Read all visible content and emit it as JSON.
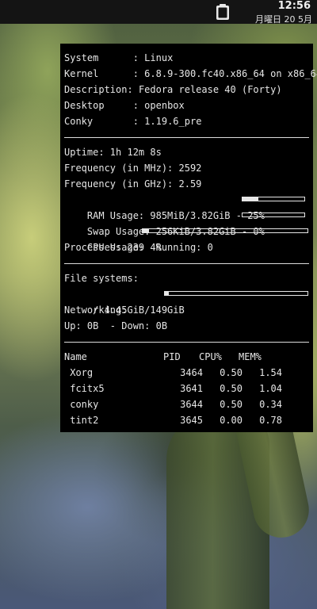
{
  "panel": {
    "time": "12:56",
    "date": "月曜日 20 5月",
    "tray_icon": "clipboard-icon"
  },
  "conky": {
    "system": [
      {
        "key": "System     ",
        "value": "Linux"
      },
      {
        "key": "Kernel     ",
        "value": "6.8.9-300.fc40.x86_64 on x86_64"
      },
      {
        "key": "Description",
        "value": "Fedora release 40 (Forty)"
      },
      {
        "key": "Desktop    ",
        "value": "openbox"
      },
      {
        "key": "Conky      ",
        "value": "1.19.6_pre"
      }
    ],
    "uptime": "Uptime: 1h 12m 8s",
    "freq_mhz": "Frequency (in MHz): 2592",
    "freq_ghz": "Frequency (in GHz): 2.59",
    "ram": {
      "text": "RAM Usage: 985MiB/3.82GiB - 25%",
      "percent": 25
    },
    "swap": {
      "text": "Swap Usage: 256KiB/3.82GiB - 0%",
      "percent": 0
    },
    "cpu": {
      "text": "CPU Usage: 4%",
      "percent": 4
    },
    "processes": "Processes: 239  Running: 0",
    "fs_header": "File systems:",
    "fs": {
      "text": " / 4.45GiB/149GiB",
      "percent": 3
    },
    "net_header": "Networking:",
    "net": "Up: 0B  - Down: 0B",
    "table": {
      "headers": [
        "Name",
        "PID",
        "CPU%",
        "MEM%"
      ],
      "rows": [
        {
          "name": " Xorg",
          "pid": "3464",
          "cpu": "0.50",
          "mem": "1.54"
        },
        {
          "name": " fcitx5",
          "pid": "3641",
          "cpu": "0.50",
          "mem": "1.04"
        },
        {
          "name": " conky",
          "pid": "3644",
          "cpu": "0.50",
          "mem": "0.34"
        },
        {
          "name": " tint2",
          "pid": "3645",
          "cpu": "0.00",
          "mem": "0.78"
        }
      ]
    }
  }
}
